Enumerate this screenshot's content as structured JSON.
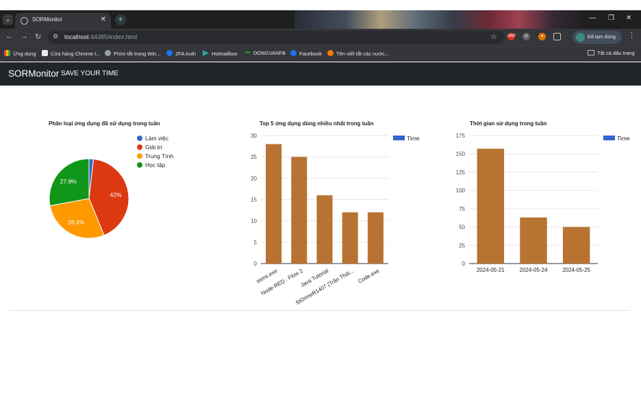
{
  "browser": {
    "tab_title": "SORMonitor",
    "url_host": "localhost",
    "url_rest": ":44385/index.html",
    "paused_label": "Đã tạm dừng",
    "bookmarks": [
      "Ứng dụng",
      "Cửa hàng Chrome t...",
      "Phím tắt trong Win...",
      "2FA Auth",
      "Hotmailbox",
      "DONGVANFB",
      "Facebook",
      "Tên viết tắt các nước..."
    ],
    "all_bookmarks": "Tất cả dấu trang"
  },
  "navbar": {
    "brand": "SORMonitor",
    "link": "SAVE YOUR TIME"
  },
  "chart_data": [
    {
      "type": "pie",
      "title": "Phân loại ứng dụng đã sử dụng trong tuần",
      "labels": [
        "Làm việc",
        "Giải trí",
        "Trung Tính",
        "Học tập"
      ],
      "values": [
        1.8,
        42,
        28.3,
        27.9
      ],
      "slice_labels": [
        "",
        "42%",
        "28.3%",
        "27.9%"
      ],
      "colors": [
        "#3366cc",
        "#dc3912",
        "#ff9900",
        "#109618"
      ],
      "legend": "right"
    },
    {
      "type": "bar",
      "title": "Top 5 ứng dụng dùng nhiều nhất trong tuần",
      "categories": [
        "ssms.exe",
        "Node-RED : Flow 2",
        "Java Tutorial",
        "StOrmeR1407 (Trần Thái...",
        "Code.exe"
      ],
      "series": [
        {
          "name": "Time",
          "values": [
            28,
            25,
            16,
            12,
            12
          ]
        }
      ],
      "ylim": [
        0,
        30
      ],
      "yticks": [
        0,
        5,
        10,
        15,
        20,
        25,
        30
      ],
      "color": "#b87333",
      "legend": "top-right",
      "grid": true
    },
    {
      "type": "bar",
      "title": "Thời gian sử dụng trong tuần",
      "categories": [
        "2024-05-21",
        "2024-05-24",
        "2024-05-25"
      ],
      "series": [
        {
          "name": "Time",
          "values": [
            157,
            63,
            50
          ]
        }
      ],
      "ylim": [
        0,
        175
      ],
      "yticks": [
        0,
        25,
        50,
        75,
        100,
        125,
        150,
        175
      ],
      "color": "#b87333",
      "legend": "top-right",
      "grid": true
    }
  ]
}
